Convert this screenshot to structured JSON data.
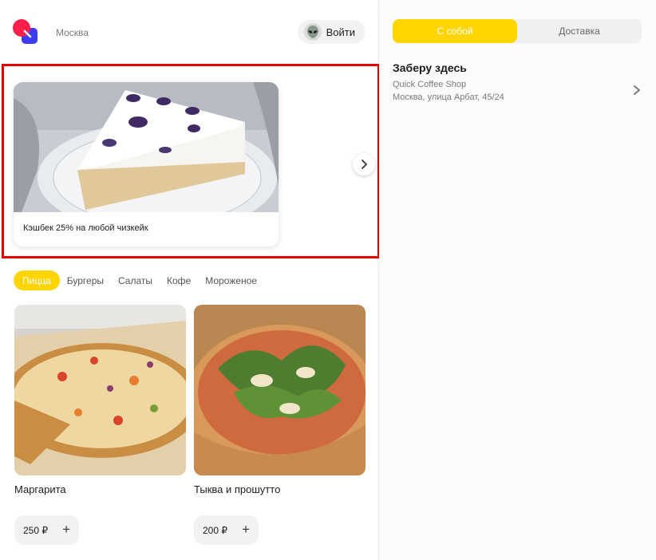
{
  "header": {
    "city": "Москва",
    "login_label": "Войти"
  },
  "promo": {
    "caption": "Кэшбек 25% на любой чизкейк"
  },
  "categories": [
    {
      "label": "Пицца",
      "active": true
    },
    {
      "label": "Бургеры",
      "active": false
    },
    {
      "label": "Салаты",
      "active": false
    },
    {
      "label": "Кофе",
      "active": false
    },
    {
      "label": "Мороженое",
      "active": false
    }
  ],
  "products": [
    {
      "name": "Маргарита",
      "price": "250 ₽"
    },
    {
      "name": "Тыква и прошутто",
      "price": "200 ₽"
    }
  ],
  "delivery_mode": {
    "options": [
      "С собой",
      "Доставка"
    ],
    "selected": "С собой"
  },
  "pickup": {
    "title": "Заберу здесь",
    "shop": "Quick Coffee Shop",
    "address": "Москва, улица Арбат, 45/24"
  },
  "colors": {
    "accent": "#ffd500",
    "highlight_frame": "#e60000",
    "logo_red": "#ff1f4b",
    "logo_blue": "#3d3df5"
  },
  "icons": {
    "logo": "brand-logo-icon",
    "avatar": "alien-avatar-icon",
    "carousel_next": "chevron-right-icon",
    "add": "plus-icon",
    "pickup_chevron": "chevron-right-icon"
  }
}
